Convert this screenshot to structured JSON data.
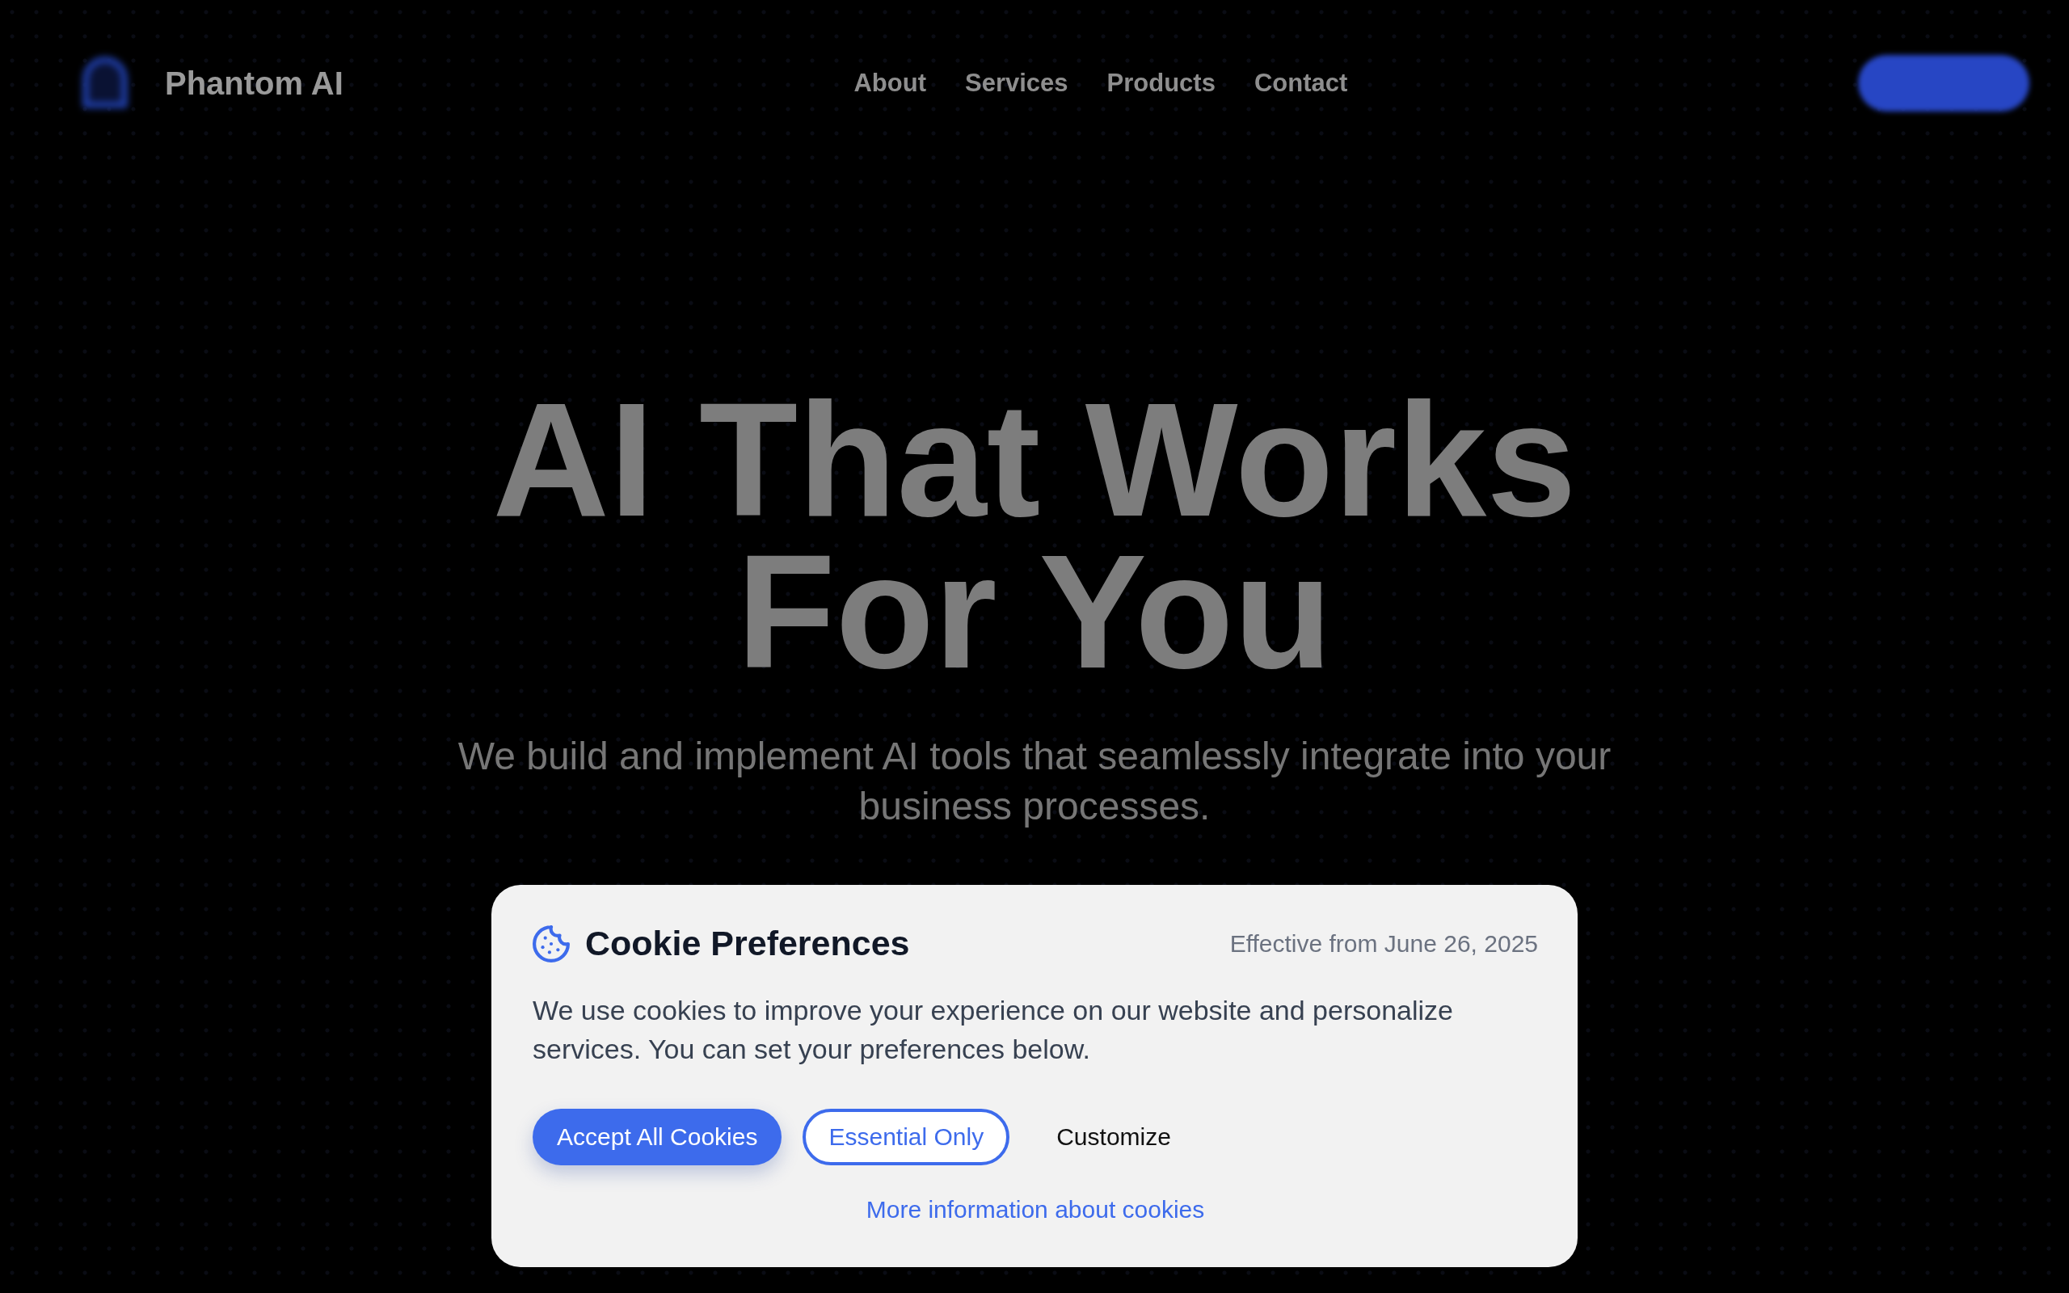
{
  "header": {
    "brand": "Phantom AI",
    "nav": [
      "About",
      "Services",
      "Products",
      "Contact"
    ]
  },
  "hero": {
    "heading": "AI That Works For You",
    "subtitle": "We build and implement AI tools that seamlessly integrate into your business processes."
  },
  "cookie_banner": {
    "title": "Cookie Preferences",
    "effective_date": "Effective from June 26, 2025",
    "message": "We use cookies to improve your experience on our website and personalize services. You can set your preferences below.",
    "buttons": [
      {
        "label": "Accept All Cookies",
        "kind": "primary"
      },
      {
        "label": "Essential Only",
        "kind": "outline"
      },
      {
        "label": "Customize",
        "kind": "text"
      }
    ],
    "link": "More information about cookies"
  }
}
